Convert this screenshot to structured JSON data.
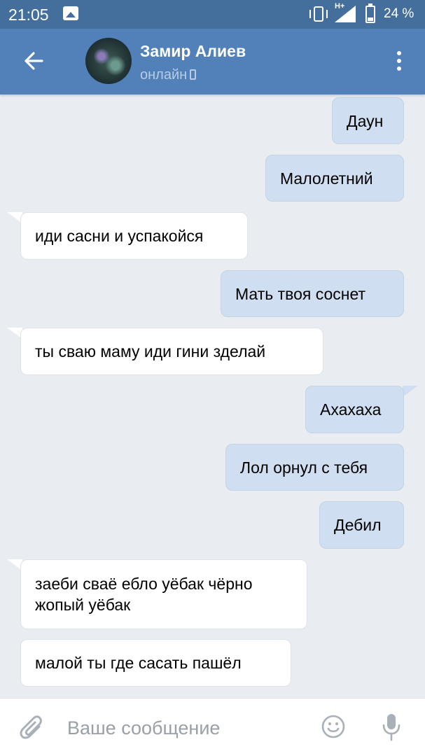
{
  "status_bar": {
    "time": "21:05",
    "network": "H+",
    "battery": "24 %"
  },
  "header": {
    "name": "Замир Алиев",
    "status": "онлайн"
  },
  "messages": [
    {
      "dir": "out",
      "text": "Даун"
    },
    {
      "dir": "out",
      "text": "Малолетний"
    },
    {
      "dir": "in",
      "text": "иди сасни и успакойся"
    },
    {
      "dir": "out",
      "text": "Мать твоя соснет"
    },
    {
      "dir": "in",
      "text": "ты сваю маму иди гини зделай"
    },
    {
      "dir": "out",
      "text": "Ахахаха"
    },
    {
      "dir": "out",
      "text": "Лол орнул с тебя"
    },
    {
      "dir": "out",
      "text": "Дебил"
    },
    {
      "dir": "in",
      "text": "заеби сваё ебло уёбак чёрно жопый уёбак"
    },
    {
      "dir": "in",
      "text": "малой ты где сасать пашёл"
    }
  ],
  "composer": {
    "placeholder": "Ваше сообщение"
  },
  "colors": {
    "status_bar": "#446f9c",
    "header": "#5181b8",
    "background": "#e9edf2",
    "outgoing_bubble": "#cfdef0",
    "incoming_bubble": "#ffffff"
  }
}
